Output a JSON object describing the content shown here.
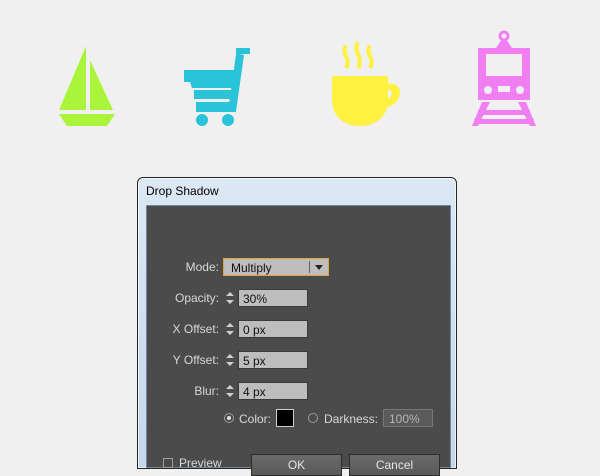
{
  "icons": [
    {
      "name": "sailboat-icon",
      "color": "#aaf53c"
    },
    {
      "name": "shopping-cart-icon",
      "color": "#2bc3d8"
    },
    {
      "name": "coffee-cup-icon",
      "color": "#fff13f"
    },
    {
      "name": "train-icon",
      "color": "#f27ff2"
    }
  ],
  "dialog": {
    "title": "Drop Shadow",
    "mode": {
      "label": "Mode:",
      "value": "Multiply"
    },
    "opacity": {
      "label": "Opacity:",
      "value": "30%"
    },
    "x_offset": {
      "label": "X Offset:",
      "value": "0 px"
    },
    "y_offset": {
      "label": "Y Offset:",
      "value": "5 px"
    },
    "blur": {
      "label": "Blur:",
      "value": "4 px"
    },
    "color": {
      "label": "Color:",
      "swatch": "#000000",
      "selected": true
    },
    "darkness": {
      "label": "Darkness:",
      "value": "100%"
    },
    "preview": {
      "label": "Preview",
      "checked": false
    },
    "ok_label": "OK",
    "cancel_label": "Cancel"
  }
}
